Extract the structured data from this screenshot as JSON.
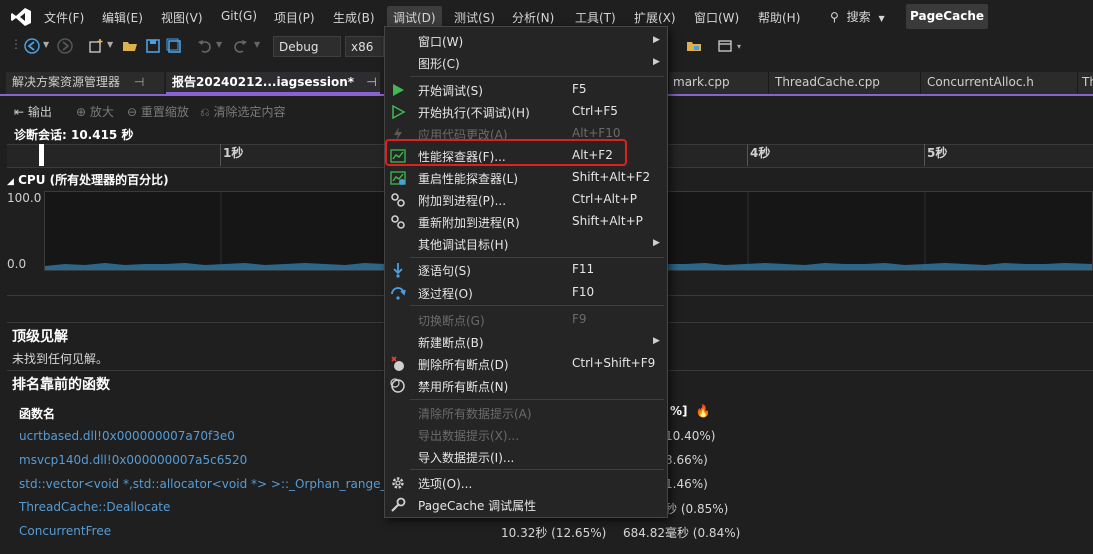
{
  "menubar": {
    "items": [
      "文件(F)",
      "编辑(E)",
      "视图(V)",
      "Git(G)",
      "项目(P)",
      "生成(B)",
      "调试(D)",
      "测试(S)",
      "分析(N)",
      "工具(T)",
      "扩展(X)",
      "窗口(W)",
      "帮助(H)"
    ],
    "search": "搜索",
    "project": "PageCache"
  },
  "toolbar": {
    "config": "Debug",
    "platform": "x86"
  },
  "tabs": {
    "solution_explorer": "解决方案资源管理器",
    "report": "报告20240212...iagsession*",
    "right": [
      "mark.cpp",
      "ThreadCache.cpp",
      "ConcurrentAlloc.h",
      "Th"
    ]
  },
  "report": {
    "output": "输出",
    "zoom_in": "放大",
    "reset_zoom": "重置缩放",
    "clear_selection": "清除选定内容",
    "session": "诊断会话: 10.415 秒",
    "ticks": [
      "1秒",
      "4秒",
      "5秒"
    ],
    "cpu_title": "CPU (所有处理器的百分比)",
    "y_max": "100.0",
    "y_min": "0.0",
    "insights_title": "顶级见解",
    "insights_text": "未找到任何见解。",
    "top_functions_title": "排名靠前的函数",
    "col_function_name": "函数名",
    "col_partial": "%]",
    "functions": [
      {
        "name": "ucrtbased.dll!0x000000007a70f3e0",
        "total": "",
        "self": "10.40%)"
      },
      {
        "name": "msvcp140d.dll!0x000000007a5c6520",
        "total": "",
        "self": "3.66%)"
      },
      {
        "name": "std::vector<void *,std::allocator<void *> >::_Orphan_range_lock",
        "total": "",
        "self": "1.46%)"
      },
      {
        "name": "ThreadCache::Deallocate",
        "total": "",
        "self": "秒 (0.85%)"
      },
      {
        "name": "ConcurrentFree",
        "total": "10.32秒 (12.65%)",
        "self": "684.82毫秒 (0.84%)"
      }
    ]
  },
  "debug_menu": {
    "items": [
      {
        "label": "窗口(W)",
        "shortcut": "",
        "submenu": true,
        "disabled": false,
        "icon": ""
      },
      {
        "label": "图形(C)",
        "shortcut": "",
        "submenu": true,
        "disabled": false,
        "icon": ""
      },
      {
        "label": "开始调试(S)",
        "shortcut": "F5",
        "submenu": false,
        "disabled": false,
        "icon": "play-icon"
      },
      {
        "label": "开始执行(不调试)(H)",
        "shortcut": "Ctrl+F5",
        "submenu": false,
        "disabled": false,
        "icon": "play-outline-icon"
      },
      {
        "label": "应用代码更改(A)",
        "shortcut": "Alt+F10",
        "submenu": false,
        "disabled": true,
        "icon": "hot-reload-icon"
      },
      {
        "label": "性能探查器(F)...",
        "shortcut": "Alt+F2",
        "submenu": false,
        "disabled": false,
        "icon": "profiler-icon"
      },
      {
        "label": "重启性能探查器(L)",
        "shortcut": "Shift+Alt+F2",
        "submenu": false,
        "disabled": false,
        "icon": "profiler-restart-icon"
      },
      {
        "label": "附加到进程(P)...",
        "shortcut": "Ctrl+Alt+P",
        "submenu": false,
        "disabled": false,
        "icon": "gears-icon"
      },
      {
        "label": "重新附加到进程(R)",
        "shortcut": "Shift+Alt+P",
        "submenu": false,
        "disabled": false,
        "icon": "gears-icon"
      },
      {
        "label": "其他调试目标(H)",
        "shortcut": "",
        "submenu": true,
        "disabled": false,
        "icon": ""
      },
      {
        "label": "逐语句(S)",
        "shortcut": "F11",
        "submenu": false,
        "disabled": false,
        "icon": "step-into-icon"
      },
      {
        "label": "逐过程(O)",
        "shortcut": "F10",
        "submenu": false,
        "disabled": false,
        "icon": "step-over-icon"
      },
      {
        "label": "切换断点(G)",
        "shortcut": "F9",
        "submenu": false,
        "disabled": true,
        "icon": ""
      },
      {
        "label": "新建断点(B)",
        "shortcut": "",
        "submenu": true,
        "disabled": false,
        "icon": ""
      },
      {
        "label": "删除所有断点(D)",
        "shortcut": "Ctrl+Shift+F9",
        "submenu": false,
        "disabled": false,
        "icon": "delete-breakpoints-icon"
      },
      {
        "label": "禁用所有断点(N)",
        "shortcut": "",
        "submenu": false,
        "disabled": false,
        "icon": "disable-breakpoints-icon"
      },
      {
        "label": "清除所有数据提示(A)",
        "shortcut": "",
        "submenu": false,
        "disabled": true,
        "icon": ""
      },
      {
        "label": "导出数据提示(X)...",
        "shortcut": "",
        "submenu": false,
        "disabled": true,
        "icon": ""
      },
      {
        "label": "导入数据提示(I)...",
        "shortcut": "",
        "submenu": false,
        "disabled": false,
        "icon": ""
      },
      {
        "label": "选项(O)...",
        "shortcut": "",
        "submenu": false,
        "disabled": false,
        "icon": "gear-icon"
      },
      {
        "label": "PageCache 调试属性",
        "shortcut": "",
        "submenu": false,
        "disabled": false,
        "icon": "wrench-icon"
      }
    ]
  },
  "colors": {
    "accent": "#8a63d2",
    "highlight": "#e02020",
    "link": "#569cd6"
  }
}
